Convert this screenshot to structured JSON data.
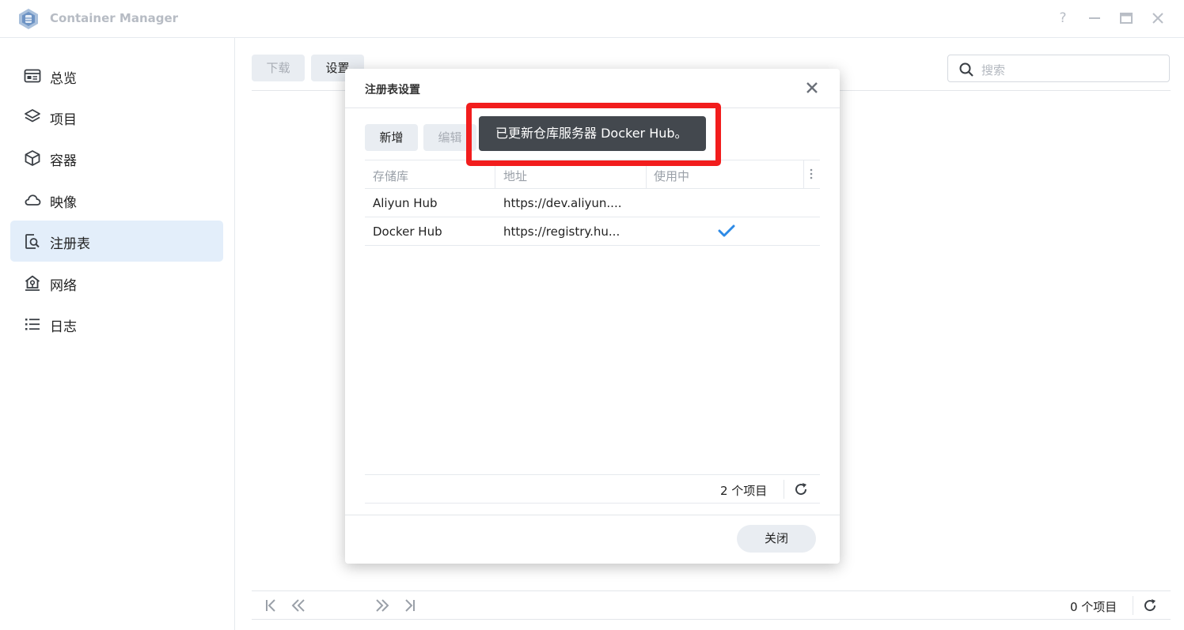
{
  "app": {
    "title": "Container Manager"
  },
  "window_controls": {
    "help": "?"
  },
  "sidebar": {
    "items": [
      {
        "label": "总览",
        "icon": "overview-icon"
      },
      {
        "label": "项目",
        "icon": "layers-icon"
      },
      {
        "label": "容器",
        "icon": "cube-icon"
      },
      {
        "label": "映像",
        "icon": "cloud-icon"
      },
      {
        "label": "注册表",
        "icon": "registry-search-icon",
        "active": true
      },
      {
        "label": "网络",
        "icon": "network-home-icon"
      },
      {
        "label": "日志",
        "icon": "list-icon"
      }
    ]
  },
  "toolbar": {
    "download_label": "下载",
    "settings_label": "设置"
  },
  "search": {
    "placeholder": "搜索"
  },
  "pager": {
    "count_label": "0 个项目"
  },
  "modal": {
    "title": "注册表设置",
    "add_label": "新增",
    "edit_label": "编辑",
    "columns": {
      "repo": "存储库",
      "address": "地址",
      "in_use": "使用中"
    },
    "rows": [
      {
        "repo": "Aliyun Hub",
        "address": "https://dev.aliyun....",
        "in_use": false
      },
      {
        "repo": "Docker Hub",
        "address": "https://registry.hu...",
        "in_use": true
      }
    ],
    "count_label": "2 个项目",
    "close_label": "关闭"
  },
  "toast": {
    "message": "已更新仓库服务器 Docker Hub。"
  },
  "colors": {
    "accent": "#2d8ae6",
    "highlight": "#f21d1d",
    "active_bg": "#e3eefa",
    "toast_bg": "#43484e"
  }
}
